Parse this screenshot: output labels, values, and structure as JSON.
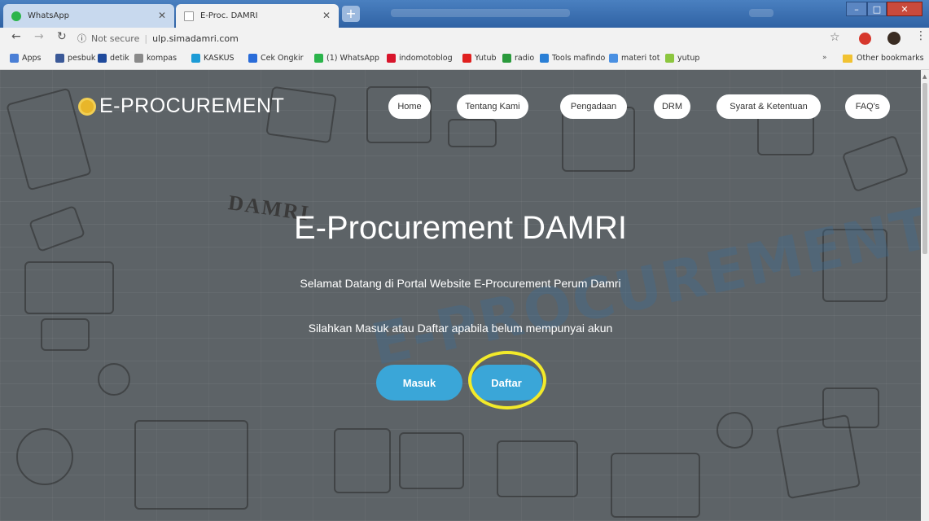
{
  "browser": {
    "tabs": [
      {
        "title": "WhatsApp",
        "icon": "whatsapp-icon",
        "active": false
      },
      {
        "title": "E-Proc. DAMRI",
        "icon": "page-icon",
        "active": true
      }
    ],
    "address": {
      "security": "Not secure",
      "url": "ulp.simadamri.com"
    },
    "bookmarks": [
      {
        "label": "Apps",
        "icon": "apps-icon",
        "color": "#4a7fd6"
      },
      {
        "label": "pesbuk",
        "icon": "facebook-icon",
        "color": "#3b5998"
      },
      {
        "label": "detik",
        "icon": "detik-icon",
        "color": "#1f4a9c"
      },
      {
        "label": "kompas",
        "icon": "kompas-icon",
        "color": "#8a8a8a"
      },
      {
        "label": "KASKUS",
        "icon": "kaskus-icon",
        "color": "#1c9bd6"
      },
      {
        "label": "Cek Ongkir",
        "icon": "cekongkir-icon",
        "color": "#2a6cd9"
      },
      {
        "label": "(1) WhatsApp",
        "icon": "whatsapp-icon",
        "color": "#2bb44b"
      },
      {
        "label": "indomotoblog",
        "icon": "indomotoblog-icon",
        "color": "#d8152b"
      },
      {
        "label": "Yutub",
        "icon": "youtube-icon",
        "color": "#e0201f"
      },
      {
        "label": "radio",
        "icon": "radio-icon",
        "color": "#2a9a3c"
      },
      {
        "label": "Tools mafindo",
        "icon": "tools-icon",
        "color": "#2a7fd6"
      },
      {
        "label": "materi tot",
        "icon": "document-icon",
        "color": "#4a90e2"
      },
      {
        "label": "yutup",
        "icon": "yutup-icon",
        "color": "#8cc63f"
      }
    ],
    "bookmarks_more": "»",
    "other_bookmarks": "Other bookmarks"
  },
  "site": {
    "logo_text": "E-PROCUREMENT",
    "nav": [
      "Home",
      "Tentang Kami",
      "Pengadaan",
      "DRM",
      "Syarat & Ketentuan",
      "FAQ's"
    ],
    "badge": "DAMRI",
    "stamp": "E-PROCUREMENT",
    "hero_title": "E-Procurement DAMRI",
    "hero_sub": "Selamat Datang di Portal Website E-Procurement Perum Damri",
    "hero_sub2": "Silahkan Masuk atau Daftar apabila belum mempunyai akun",
    "login_label": "Masuk",
    "register_label": "Daftar"
  },
  "colors": {
    "accent_button": "#3aa6d8",
    "highlight_ring": "#f2ea2a",
    "tab_bar": "#3a6fb0"
  }
}
